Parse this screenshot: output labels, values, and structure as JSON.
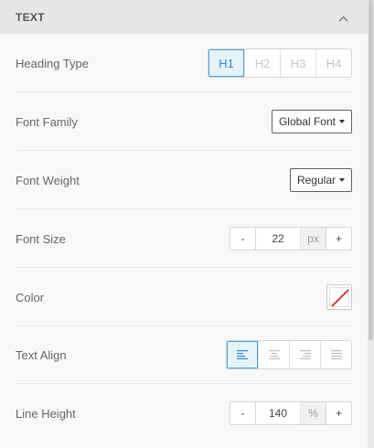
{
  "section": {
    "title": "TEXT",
    "collapse_icon": "chevron-up-icon"
  },
  "heading_type": {
    "label": "Heading Type",
    "options": [
      "H1",
      "H2",
      "H3",
      "H4"
    ],
    "selected": "H1"
  },
  "font_family": {
    "label": "Font Family",
    "value": "Global Font"
  },
  "font_weight": {
    "label": "Font Weight",
    "value": "Regular"
  },
  "font_size": {
    "label": "Font Size",
    "decrement": "-",
    "value": "22",
    "unit": "px",
    "increment": "+"
  },
  "color": {
    "label": "Color",
    "value_icon": "no-color-swatch",
    "slash_color": "#e02020"
  },
  "text_align": {
    "label": "Text Align",
    "options": [
      "align-left-icon",
      "align-center-icon",
      "align-right-icon",
      "align-justify-icon"
    ],
    "selected": "align-left-icon"
  },
  "line_height": {
    "label": "Line Height",
    "decrement": "-",
    "value": "140",
    "unit": "%",
    "increment": "+"
  },
  "colors": {
    "accent": "#2a8ad6",
    "accent_bg": "#e7f3fb",
    "header_bg": "#e6e6e6"
  }
}
